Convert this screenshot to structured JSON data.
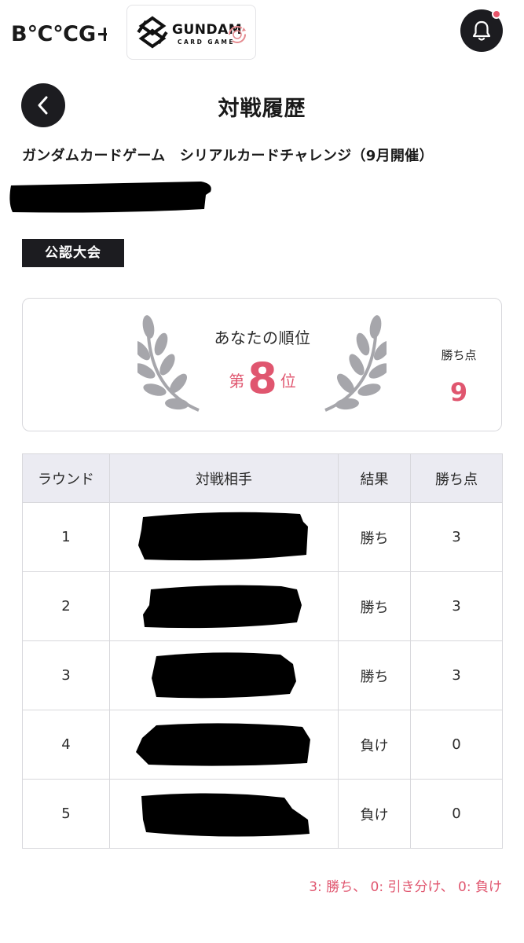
{
  "header": {
    "brand_logo_text": "B℃℃G+",
    "game_logo": {
      "title": "GUNDAM",
      "subtitle": "CARD GAME"
    },
    "notification_icon": "bell-icon",
    "notification_badge_color": "#e8556a"
  },
  "page": {
    "title": "対戦履歴",
    "back_icon": "chevron-left-icon",
    "event_name": "ガンダムカードゲーム　シリアルカードチャレンジ（9月開催）",
    "category_badge": "公認大会"
  },
  "rank_card": {
    "label": "あなたの順位",
    "prefix": "第",
    "rank": "8",
    "suffix": "位",
    "points_label": "勝ち点",
    "points_value": "9",
    "accent_color": "#e0566f"
  },
  "table": {
    "headers": [
      "ラウンド",
      "対戦相手",
      "結果",
      "勝ち点"
    ],
    "rows": [
      {
        "round": "1",
        "result": "勝ち",
        "points": "3"
      },
      {
        "round": "2",
        "result": "勝ち",
        "points": "3"
      },
      {
        "round": "3",
        "result": "勝ち",
        "points": "3"
      },
      {
        "round": "4",
        "result": "負け",
        "points": "0"
      },
      {
        "round": "5",
        "result": "負け",
        "points": "0"
      }
    ]
  },
  "legend": "3: 勝ち、 0: 引き分け、 0: 負け"
}
